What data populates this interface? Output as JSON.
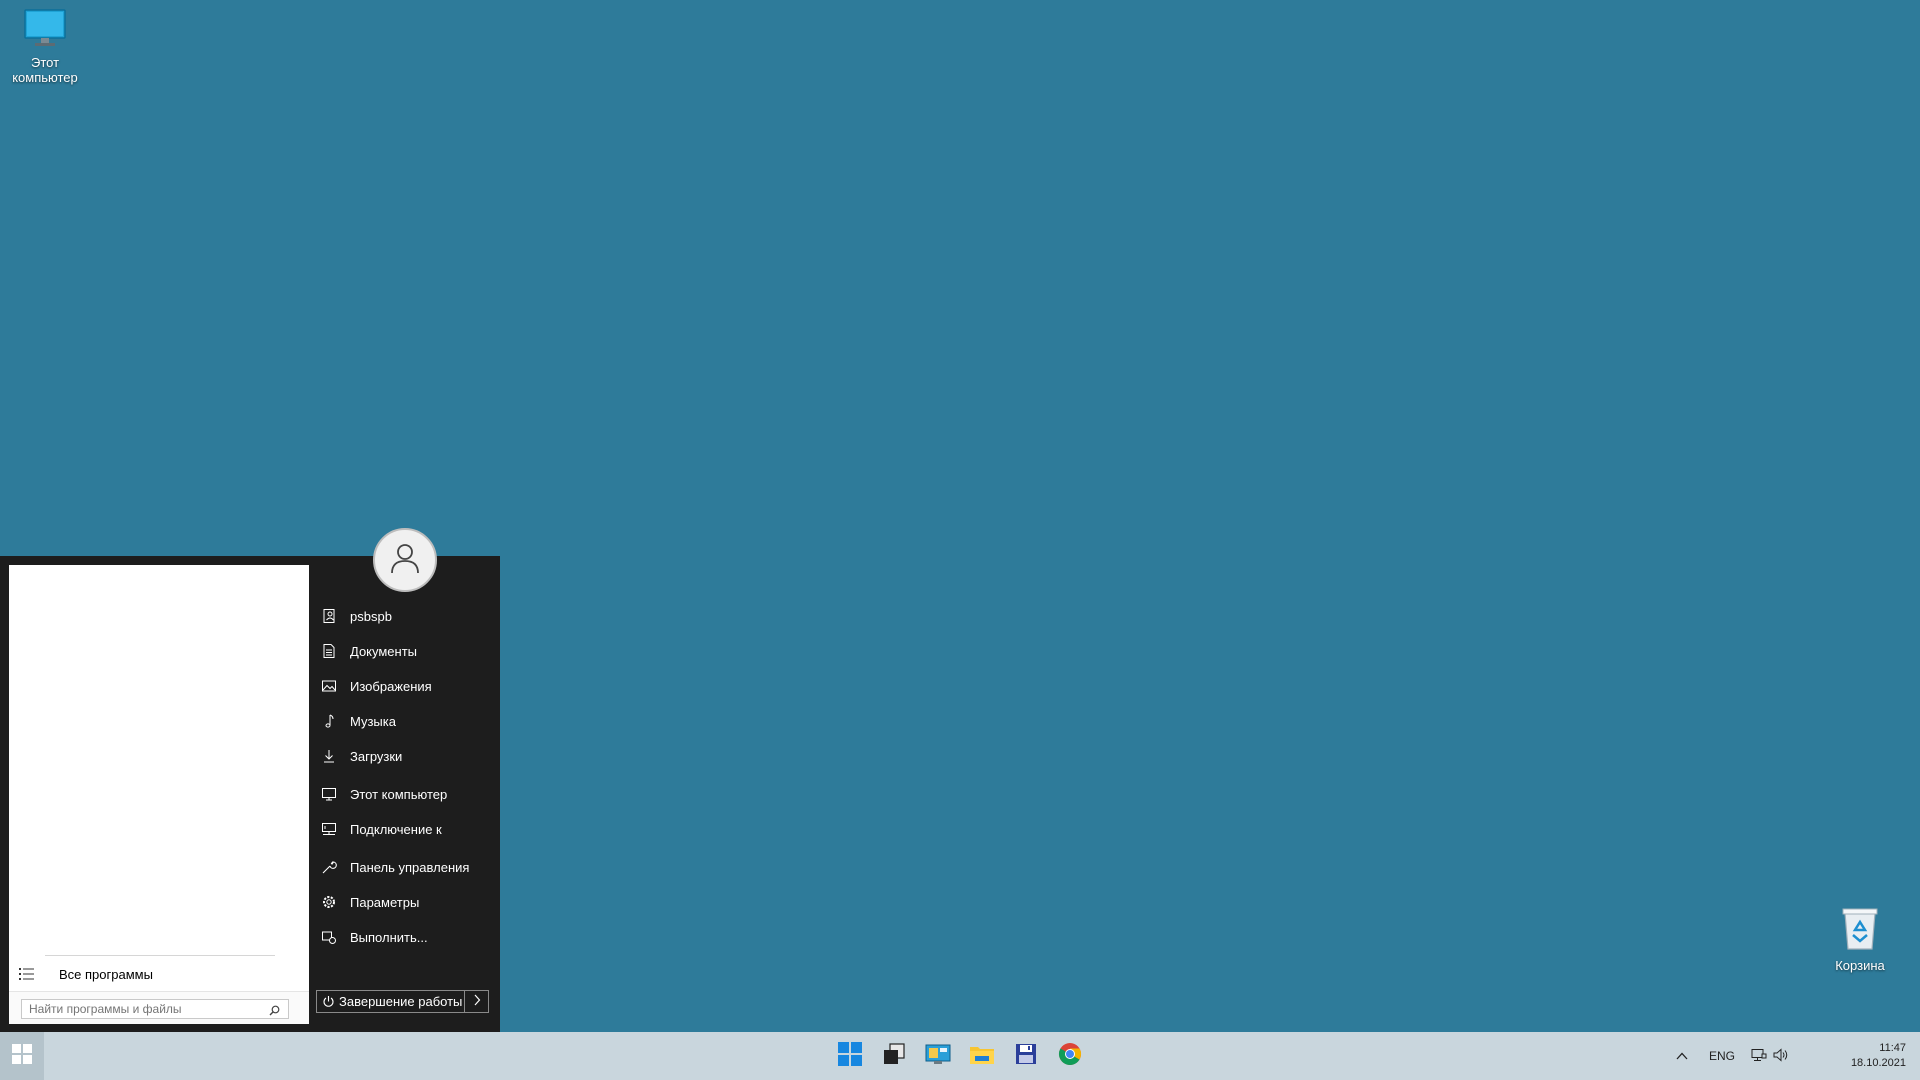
{
  "desktop": {
    "computer_icon_label": "Этот компьютер",
    "computer_icon": "monitor-icon",
    "recycle_icon_label": "Корзина",
    "recycle_icon": "recycle-bin-icon",
    "background_color": "#2e7b9a"
  },
  "start_menu": {
    "avatar_icon": "user-avatar-icon",
    "all_programs_label": "Все программы",
    "search_placeholder": "Найти программы и файлы",
    "right_items": [
      {
        "label": "psbspb",
        "icon": "user-folder-icon"
      },
      {
        "label": "Документы",
        "icon": "document-icon"
      },
      {
        "label": "Изображения",
        "icon": "image-icon"
      },
      {
        "label": "Музыка",
        "icon": "music-icon"
      },
      {
        "label": "Загрузки",
        "icon": "download-icon"
      },
      {
        "label": "Этот компьютер",
        "icon": "computer-icon"
      },
      {
        "label": "Подключение к",
        "icon": "network-connection-icon"
      },
      {
        "label": "Панель управления",
        "icon": "wrench-icon"
      },
      {
        "label": "Параметры",
        "icon": "gear-icon"
      },
      {
        "label": "Выполнить...",
        "icon": "run-icon"
      }
    ],
    "shutdown_label": "Завершение работы"
  },
  "taskbar": {
    "apps": [
      {
        "name": "windows-start-app",
        "icon": "windows-logo-icon"
      },
      {
        "name": "task-view-app",
        "icon": "task-view-icon"
      },
      {
        "name": "control-panel-app",
        "icon": "control-panel-icon"
      },
      {
        "name": "file-explorer-app",
        "icon": "folder-icon"
      },
      {
        "name": "save-app",
        "icon": "floppy-disk-icon"
      },
      {
        "name": "chrome-app",
        "icon": "chrome-icon"
      }
    ],
    "tray": {
      "language": "ENG",
      "time": "11:47",
      "date": "18.10.2021"
    }
  }
}
